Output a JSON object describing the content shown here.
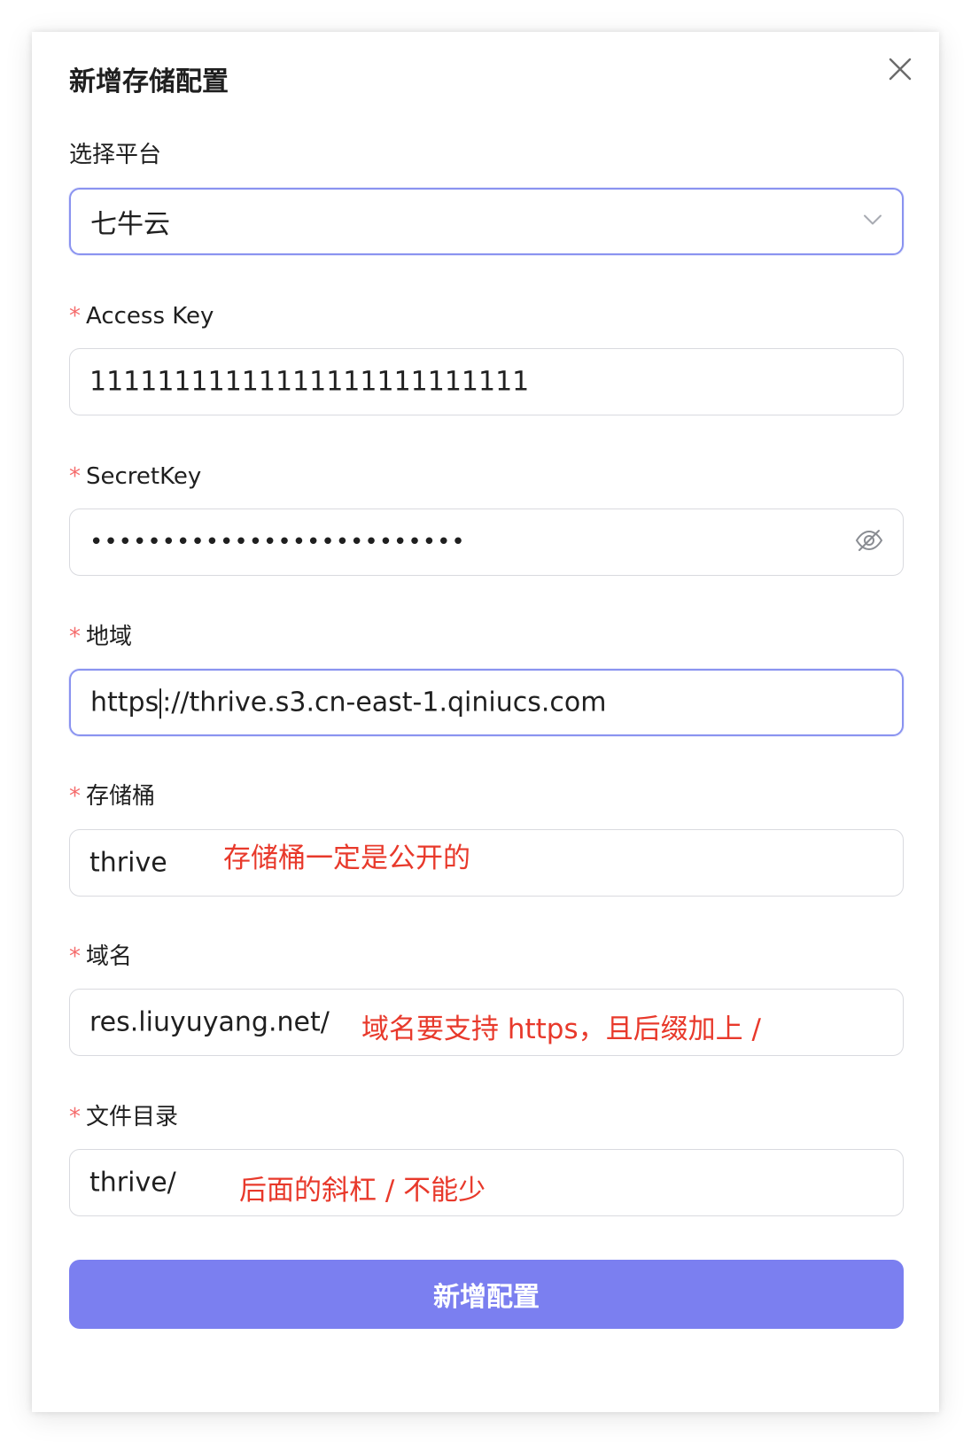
{
  "dialog": {
    "title": "新增存储配置",
    "close_icon": "close-icon"
  },
  "fields": {
    "platform": {
      "label": "选择平台",
      "value": "七牛云",
      "icon": "chevron-down-icon"
    },
    "access_key": {
      "required_mark": "*",
      "label": "Access Key",
      "value": "11111111111111111111111111"
    },
    "secret_key": {
      "required_mark": "*",
      "label": "SecretKey",
      "value": "••••••••••••••••••••••••••",
      "icon": "eye-off-icon"
    },
    "region": {
      "required_mark": "*",
      "label": "地域",
      "value_before_caret": "https",
      "value_after_caret": "://thrive.s3.cn-east-1.qiniucs.com"
    },
    "bucket": {
      "required_mark": "*",
      "label": "存储桶",
      "value": "thrive",
      "note": "存储桶一定是公开的"
    },
    "domain": {
      "required_mark": "*",
      "label": "域名",
      "value": "res.liuyuyang.net/",
      "note": "域名要支持 https，且后缀加上 /"
    },
    "directory": {
      "required_mark": "*",
      "label": "文件目录",
      "value": "thrive/",
      "note": "后面的斜杠 / 不能少"
    }
  },
  "submit": {
    "label": "新增配置"
  },
  "colors": {
    "primary": "#7b7ff0",
    "required": "#f56c6c",
    "annotation": "#e8392b",
    "focus_border": "#8a93f0"
  }
}
